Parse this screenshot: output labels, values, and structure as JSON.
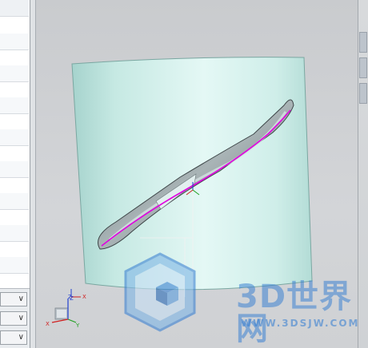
{
  "left_panel": {
    "dropdowns": [
      {
        "value": "",
        "chevron": "chevron-down-icon"
      },
      {
        "value": "",
        "chevron": "chevron-down-icon"
      },
      {
        "value": "",
        "chevron": "chevron-down-icon"
      }
    ]
  },
  "viewport": {
    "triad": {
      "x_label": "X",
      "y_label": "Y",
      "z_label": "Z"
    },
    "center_triad": {
      "x_label": "X",
      "y_label": "Y",
      "z_label": "Z"
    },
    "colors": {
      "body_face": "#cdeee8",
      "body_shadow": "#a9d6d0",
      "slot_inner": "#6f7f82",
      "curve": "#e000e0",
      "axis_x": "#d02020",
      "axis_y": "#20a020",
      "axis_z": "#2040d0"
    }
  },
  "watermark": {
    "brand": "3D世界网",
    "url": "WWW.3DSJW.COM",
    "logo": "cube-logo-icon",
    "color": "#3c82d2"
  }
}
